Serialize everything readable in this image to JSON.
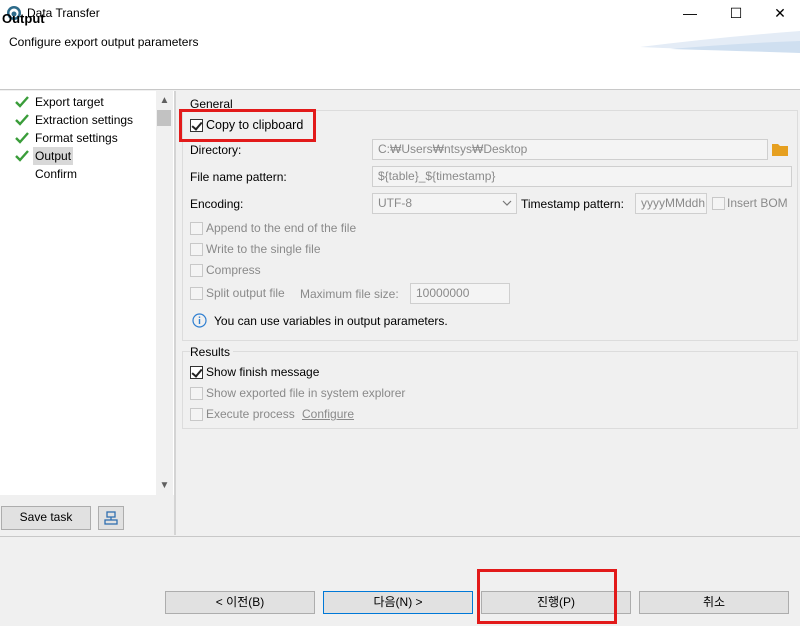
{
  "window": {
    "title": "Data Transfer",
    "minimize_glyph": "—",
    "maximize_glyph": "☐",
    "close_glyph": "✕"
  },
  "header": {
    "title": "Output",
    "description": "Configure export output parameters"
  },
  "nav": {
    "items": [
      {
        "label": "Export target",
        "checked": true
      },
      {
        "label": "Extraction settings",
        "checked": true
      },
      {
        "label": "Format settings",
        "checked": true
      },
      {
        "label": "Output",
        "checked": true,
        "selected": true
      },
      {
        "label": "Confirm",
        "checked": false
      }
    ]
  },
  "left_buttons": {
    "save_task": "Save task"
  },
  "general": {
    "group_title": "General",
    "copy_to_clipboard": {
      "label": "Copy to clipboard",
      "checked": true
    },
    "directory": {
      "label": "Directory:",
      "value": "C:₩Users₩ntsys₩Desktop"
    },
    "file_name_pattern": {
      "label": "File name pattern:",
      "value": "${table}_${timestamp}"
    },
    "encoding": {
      "label": "Encoding:",
      "value": "UTF-8"
    },
    "timestamp_pattern": {
      "label": "Timestamp pattern:",
      "value": "yyyyMMddh"
    },
    "insert_bom": {
      "label": "Insert BOM",
      "checked": false
    },
    "append_to_end": {
      "label": "Append to the end of the file",
      "checked": false
    },
    "write_to_single": {
      "label": "Write to the single file",
      "checked": false
    },
    "compress": {
      "label": "Compress",
      "checked": false
    },
    "split_output": {
      "label": "Split output file",
      "checked": false
    },
    "max_file_size": {
      "label": "Maximum file size:",
      "value": "10000000"
    },
    "info_text": "You can use variables in output parameters."
  },
  "results": {
    "group_title": "Results",
    "show_finish_message": {
      "label": "Show finish message",
      "checked": true
    },
    "show_exported_file": {
      "label": "Show exported file in system explorer",
      "checked": false
    },
    "execute_process": {
      "label": "Execute process",
      "checked": false
    },
    "configure_link": "Configure"
  },
  "footer": {
    "back": "< 이전(B)",
    "next": "다음(N) >",
    "proceed": "진행(P)",
    "cancel": "취소"
  },
  "colors": {
    "highlight_red": "#e21a1a",
    "check_green": "#3a9d3a",
    "folder_orange": "#e6a020",
    "info_blue": "#2f7fd1"
  }
}
